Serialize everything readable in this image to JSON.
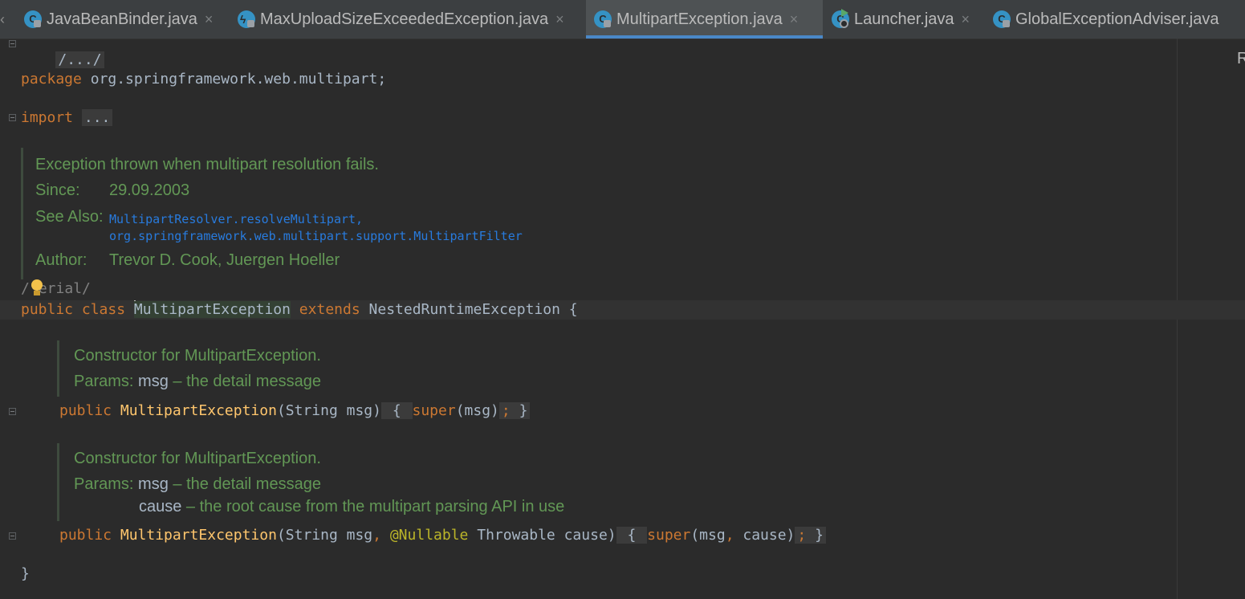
{
  "tabs": [
    {
      "label": "JavaBeanBinder.java",
      "icon": "class-icon",
      "active": false
    },
    {
      "label": "MaxUploadSizeExceededException.java",
      "icon": "exception-class-icon",
      "active": false
    },
    {
      "label": "MultipartException.java",
      "icon": "class-icon",
      "active": true
    },
    {
      "label": "Launcher.java",
      "icon": "runnable-class-icon",
      "active": false
    },
    {
      "label": "GlobalExceptionAdviser.java",
      "icon": "class-icon",
      "active": false
    }
  ],
  "right_cut_text": "R",
  "editor": {
    "folded_header": "/.../",
    "package_kw": "package",
    "package_name": " org.springframework.web.multipart;",
    "import_kw": "import",
    "import_fold": "...",
    "class_doc": {
      "description": "Exception thrown when multipart resolution fails.",
      "since_label": "Since:",
      "since_value": "29.09.2003",
      "see_also_label": "See Also:",
      "see_also_1": "MultipartResolver.resolveMultipart,",
      "see_also_2": "org.springframework.web.multipart.support.MultipartFilter",
      "author_label": "Author:",
      "author_value": "Trevor D. Cook, Juergen Hoeller"
    },
    "serial_comment_a": "/",
    "serial_comment_b": "erial/",
    "class_decl": {
      "kw1": "public class ",
      "name": "MultipartException",
      "kw2": " extends ",
      "parent": "NestedRuntimeException {"
    },
    "ctor1_doc": {
      "description": "Constructor for MultipartException.",
      "params_label": "Params: ",
      "param1_name": "msg",
      "param1_desc": " – the detail message"
    },
    "ctor1": {
      "kw": "public ",
      "name": "MultipartException",
      "args": "(String msg)",
      "open": " { ",
      "super_kw": "super",
      "super_args": "(msg)",
      "semi": "; ",
      "close": "}"
    },
    "ctor2_doc": {
      "description": "Constructor for MultipartException.",
      "params_label": "Params: ",
      "param1_name": "msg",
      "param1_desc": " – the detail message",
      "param2_name": "cause",
      "param2_desc": " – the root cause from the multipart parsing API in use"
    },
    "ctor2": {
      "kw": "public ",
      "name": "MultipartException",
      "args_a": "(String msg",
      "comma": ", ",
      "annotation": "@Nullable",
      "args_b": " Throwable cause)",
      "open": " { ",
      "super_kw": "super",
      "super_args_a": "(msg",
      "super_comma": ", ",
      "super_args_b": "cause)",
      "semi": "; ",
      "close": "}"
    },
    "closing_brace": "}"
  }
}
